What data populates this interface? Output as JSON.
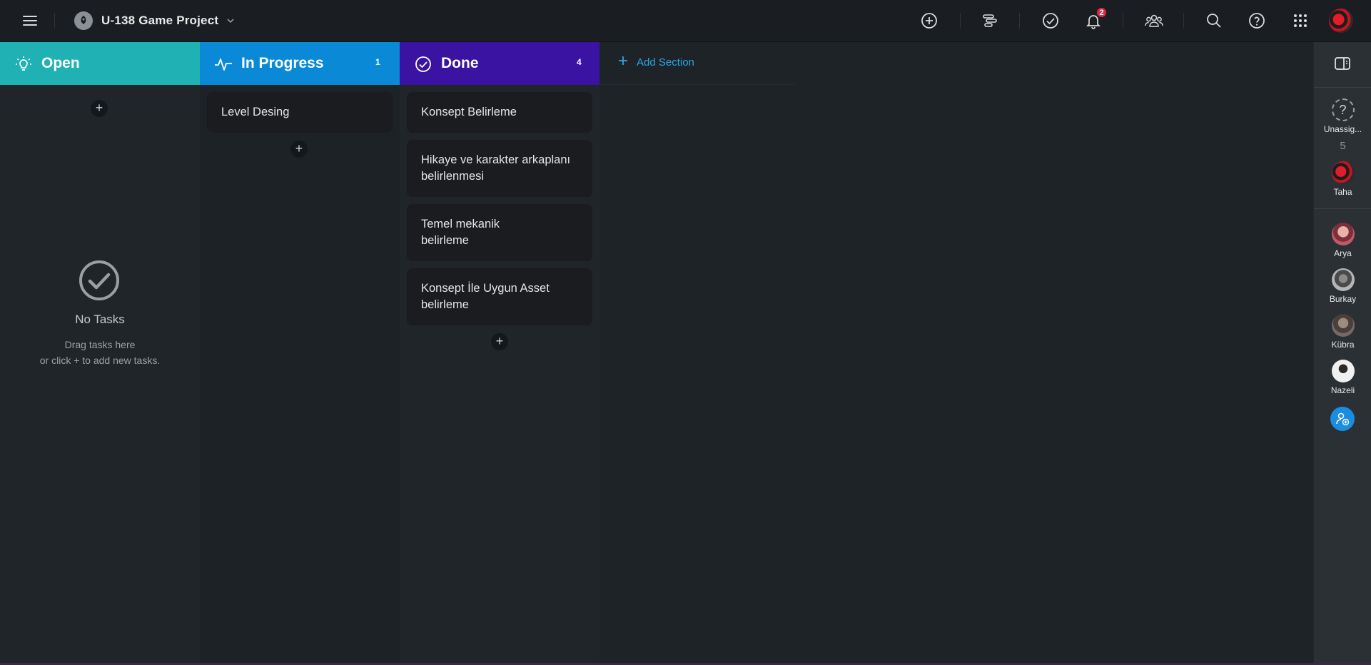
{
  "topbar": {
    "project_title": "U-138 Game Project",
    "notification_count": "2",
    "icons": [
      "menu-icon",
      "project-logo-icon",
      "chevron-down-icon",
      "add-icon",
      "timeline-icon",
      "check-circle-icon",
      "bell-icon",
      "team-icon",
      "search-icon",
      "help-icon",
      "apps-grid-icon",
      "user-avatar"
    ]
  },
  "columns": [
    {
      "title": "Open",
      "count": "",
      "color": "#1fb1b3",
      "icon": "lightbulb-icon",
      "tasks": [],
      "empty": {
        "title": "No Tasks",
        "line1": "Drag tasks here",
        "line2": "or click + to add new tasks."
      }
    },
    {
      "title": "In Progress",
      "count": "1",
      "color": "#0a8ad6",
      "icon": "activity-icon",
      "tasks": [
        "Level Desing"
      ]
    },
    {
      "title": "Done",
      "count": "4",
      "color": "#3a13a3",
      "icon": "check-circle-icon",
      "tasks": [
        "Konsept Belirleme",
        "Hikaye ve karakter arkaplanı belirlenmesi",
        "Temel mekanik belirleme",
        "Konsept İle Uygun Asset belirleme"
      ]
    }
  ],
  "add_section_label": "Add Section",
  "add_symbol": "+",
  "rail": {
    "unassigned_label": "Unassig...",
    "unassigned_count": "5",
    "members": [
      "Taha",
      "Arya",
      "Burkay",
      "Kübra",
      "Nazeli"
    ]
  }
}
